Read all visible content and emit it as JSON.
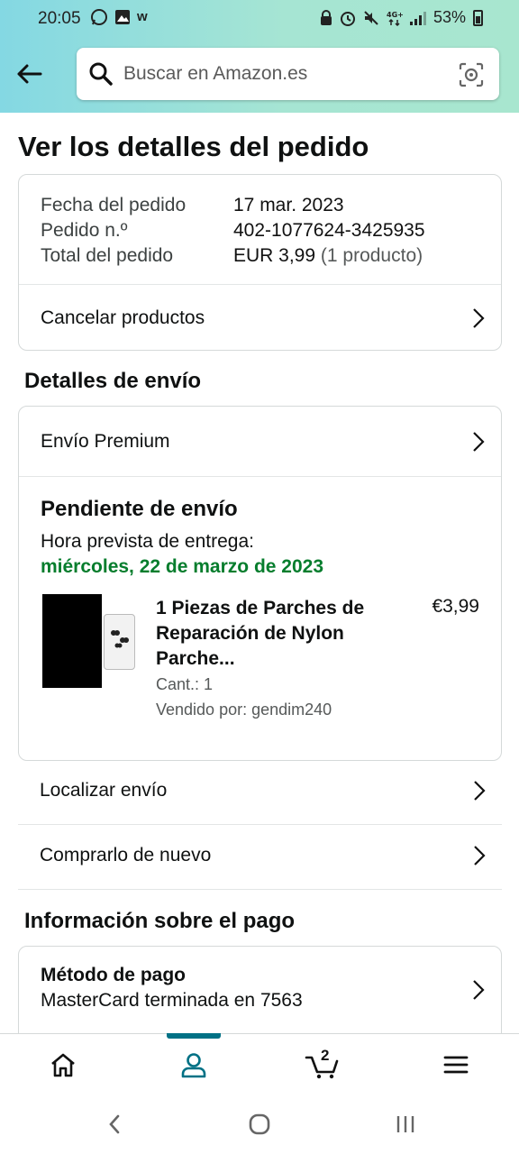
{
  "status_bar": {
    "time": "20:05",
    "battery": "53%"
  },
  "search": {
    "placeholder": "Buscar en Amazon.es"
  },
  "page": {
    "title": "Ver los detalles del pedido"
  },
  "order_summary": {
    "date_label": "Fecha del pedido",
    "date_value": "17 mar. 2023",
    "number_label": "Pedido n.º",
    "number_value": "402-1077624-3425935",
    "total_label": "Total del pedido",
    "total_value": "EUR 3,99",
    "total_note": "(1 producto)",
    "cancel_label": "Cancelar productos"
  },
  "shipping": {
    "section_title": "Detalles de envío",
    "method_label": "Envío Premium",
    "status": "Pendiente de envío",
    "eta_label": "Hora prevista de entrega:",
    "eta_date": "miércoles, 22 de marzo de 2023",
    "eta_color": "#067d2d",
    "product": {
      "name": "1 Piezas de Parches de Reparación de Nylon Parche...",
      "price": "€3,99",
      "quantity": "Cant.: 1",
      "seller": "Vendido por: gendim240"
    }
  },
  "actions": {
    "track_label": "Localizar envío",
    "buy_again_label": "Comprarlo de nuevo"
  },
  "payment": {
    "section_title": "Información sobre el pago",
    "method_title": "Método de pago",
    "method_detail": "MasterCard terminada en 7563"
  },
  "bottom_nav": {
    "items": [
      "home-icon",
      "account-icon",
      "cart-icon",
      "menu-icon"
    ],
    "active": "account-icon",
    "active_color": "#007185",
    "cart_count": "2"
  }
}
